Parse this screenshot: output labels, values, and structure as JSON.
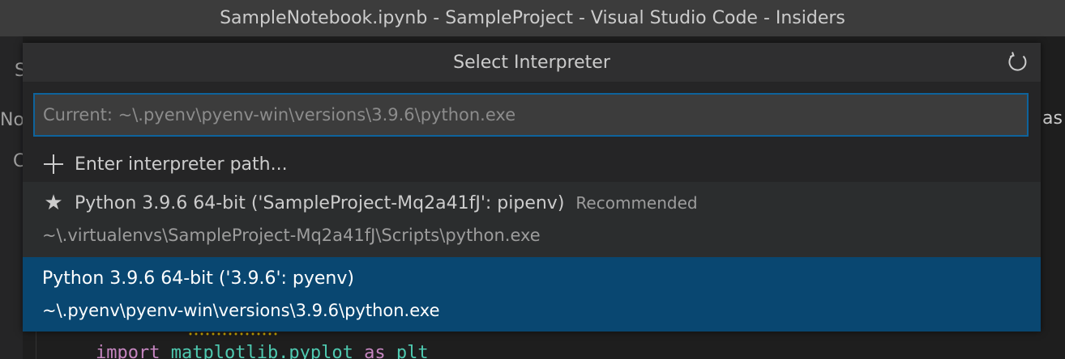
{
  "window": {
    "title": "SampleNotebook.ipynb - SampleProject - Visual Studio Code - Insiders"
  },
  "background": {
    "left_frags": [
      "S",
      "No",
      "C"
    ],
    "right_frag": "as",
    "code_line": {
      "kw": "import",
      "module": "matplotlib.pyplot",
      "as": "as",
      "alias": "plt"
    }
  },
  "quick_pick": {
    "title": "Select Interpreter",
    "refresh_icon": "refresh-icon",
    "input_placeholder": "Current: ~\\.pyenv\\pyenv-win\\versions\\3.9.6\\python.exe",
    "items": [
      {
        "icon": "plus-icon",
        "label": "Enter interpreter path..."
      },
      {
        "icon": "star-icon",
        "label": "Python 3.9.6 64-bit ('SampleProject-Mq2a41fJ': pipenv)",
        "description": "Recommended",
        "detail": "~\\.virtualenvs\\SampleProject-Mq2a41fJ\\Scripts\\python.exe"
      },
      {
        "label": "Python 3.9.6 64-bit ('3.9.6': pyenv)",
        "detail": "~\\.pyenv\\pyenv-win\\versions\\3.9.6\\python.exe",
        "selected": true
      }
    ]
  },
  "colors": {
    "selection": "#094771",
    "focus_border": "#0e639c",
    "titlebar": "#3c3c3c"
  }
}
